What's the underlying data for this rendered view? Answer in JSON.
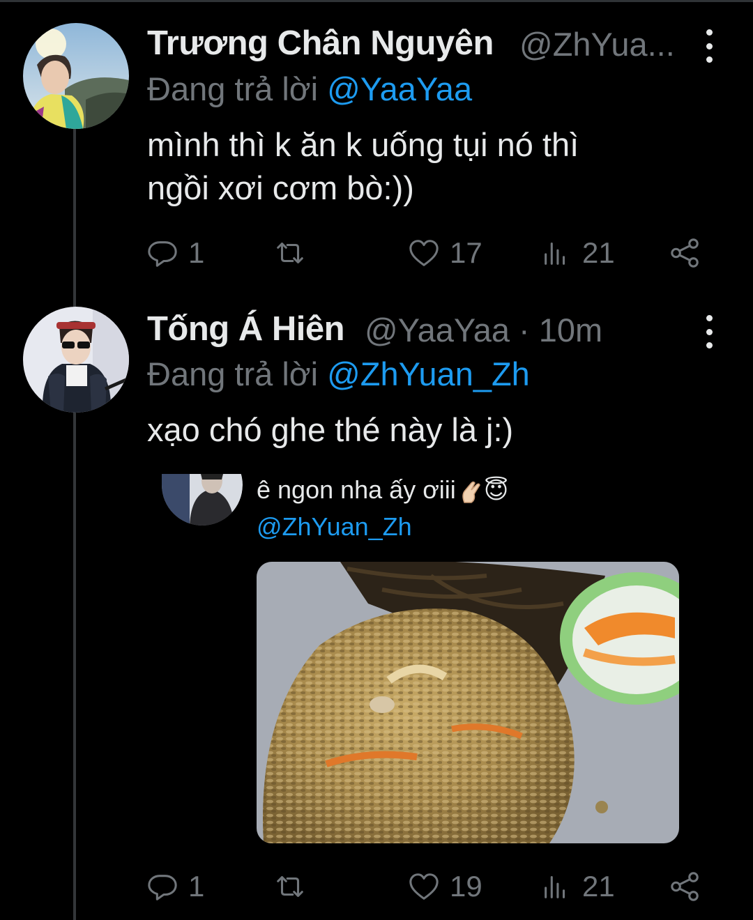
{
  "tweets": [
    {
      "display_name": "Trương Chân Nguyên",
      "handle": "@ZhYua...",
      "replying_prefix": "Đang trả lời",
      "replying_to": "@YaaYaa",
      "text_line1": "mình thì k ăn k uống tụi nó thì",
      "text_line2": "ngồi xơi cơm bò:))",
      "replies": "1",
      "retweets": "",
      "likes": "17",
      "views": "21"
    },
    {
      "display_name": "Tống Á Hiên",
      "handle": "@YaaYaa · 10m",
      "replying_prefix": "Đang trả lời",
      "replying_to": "@ZhYuan_Zh",
      "text_line1": "xạo chó ghe thé này là j:)",
      "quoted": {
        "text": "ê ngon nha ấy ơiii",
        "emoji": "😇",
        "mention": "@ZhYuan_Zh"
      },
      "replies": "1",
      "retweets": "",
      "likes": "19",
      "views": "21"
    }
  ],
  "icons": {
    "reply": "reply-icon",
    "retweet": "retweet-icon",
    "like": "like-icon",
    "views": "views-icon",
    "share": "share-icon",
    "more": "more-vertical-icon"
  },
  "colors": {
    "background": "#000000",
    "text": "#e7e9ea",
    "secondary": "#71767b",
    "accent": "#1d9bf0"
  }
}
